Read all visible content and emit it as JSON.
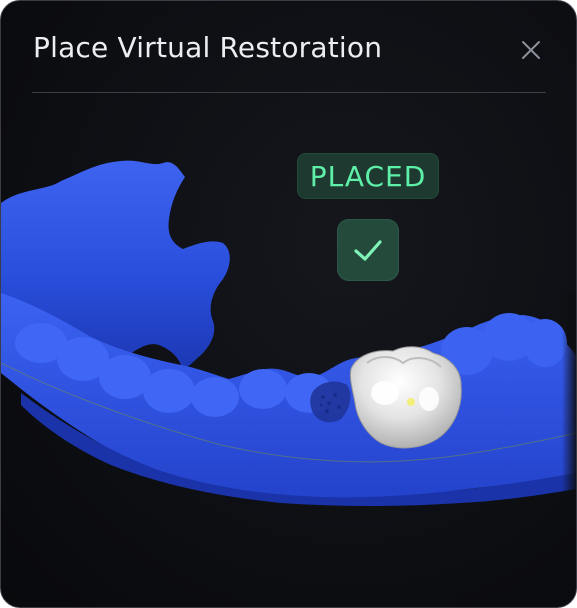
{
  "dialog": {
    "title": "Place Virtual Restoration",
    "close_icon": "close-icon"
  },
  "status": {
    "label": "PLACED",
    "icon": "checkmark-icon",
    "color": "#5ef0a8"
  },
  "scene": {
    "arch_color": "#2f55e0",
    "restoration_color": "#e6e6e6"
  }
}
